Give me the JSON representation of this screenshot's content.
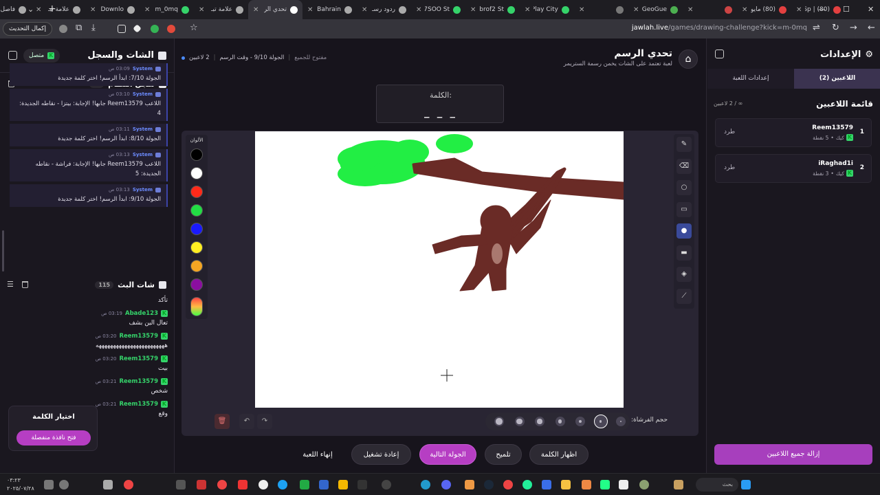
{
  "browser": {
    "tabs": [
      {
        "title": "(80) | Sp",
        "color": "#e34040"
      },
      {
        "title": "(80) مايو",
        "color": "#e34040"
      },
      {
        "title": "",
        "color": "#cc4444"
      },
      {
        "title": "GeoGue",
        "color": "#4caf50"
      },
      {
        "title": "",
        "color": "#777777"
      },
      {
        "title": "Play City",
        "color": "#35d36a"
      },
      {
        "title": "brof2 St",
        "color": "#35d36a"
      },
      {
        "title": "7SOO St",
        "color": "#35d36a"
      },
      {
        "title": "ردود رسـ",
        "color": "#aaaaaa"
      },
      {
        "title": "Bahrain",
        "color": "#aaaaaa"
      },
      {
        "title": "تحدي الر",
        "color": "#ffffff",
        "active": true
      },
      {
        "title": "علامة تبـ",
        "color": "#aaaaaa"
      },
      {
        "title": "m_0mq",
        "color": "#35d36a"
      },
      {
        "title": "Downlo",
        "color": "#aaaaaa"
      },
      {
        "title": "علامة تبـ",
        "color": "#aaaaaa"
      },
      {
        "title": "فاصل إعـ",
        "color": "#aaaaaa"
      }
    ],
    "url_host": "jawlah.live",
    "url_path": "/games/drawing-challenge?kick=m-0mq",
    "update_button": "إكمال التحديث"
  },
  "left_sidebar": {
    "title": "الشات والسجل",
    "status": "متصل",
    "system_log": {
      "title": "سجل النظام",
      "count": "22",
      "messages": [
        {
          "sender": "System",
          "time": "03:09 ص",
          "text": "الجولة 7/10: ابدأ الرسم! اختر كلمة جديدة"
        },
        {
          "sender": "System",
          "time": "03:10 ص",
          "text": "اللاعب Reem13579 جابها! الإجابة: بيتزا - نقاطه الجديدة: 4"
        },
        {
          "sender": "System",
          "time": "03:11 ص",
          "text": "الجولة 8/10: ابدأ الرسم! اختر كلمة جديدة"
        },
        {
          "sender": "System",
          "time": "03:13 ص",
          "text": "اللاعب Reem13579 جابها! الإجابة: فراشة - نقاطه الجديدة: 5"
        },
        {
          "sender": "System",
          "time": "03:13 ص",
          "text": "الجولة 9/10: ابدأ الرسم! اختر كلمة جديدة"
        }
      ]
    },
    "stream_chat": {
      "title": "شات البث",
      "count": "115",
      "messages": [
        {
          "user": "",
          "time": "",
          "text": "تأكد"
        },
        {
          "user": "Abade123",
          "time": "03:19 ص",
          "text": "تعال الين بشف"
        },
        {
          "user": "Reem13579",
          "time": "03:20 ص",
          "text": "ههههههههههههههههههههههههه"
        },
        {
          "user": "Reem13579",
          "time": "03:20 ص",
          "text": "بيت"
        },
        {
          "user": "Reem13579",
          "time": "03:21 ص",
          "text": "شخص"
        },
        {
          "user": "Reem13579",
          "time": "03:21 ص",
          "text": "وقع"
        }
      ]
    },
    "word_picker": {
      "title": "اختيار الكلمة",
      "button": "فتح نافذة منفصلة"
    }
  },
  "main": {
    "title": "تحدي الرسم",
    "subtitle": "لعبة تعتمد على الشات يخمن رسمة الستريمر",
    "players_count": "2 لاعبين",
    "round_info": "الجولة 9/10 - وقت الرسم",
    "mode": "مفتوح للجميع",
    "word_label": "الكلمة:",
    "word_mask": "_ _ _",
    "colors_label": "الألوان",
    "colors": [
      "#000000",
      "#ffffff",
      "#ff2a1a",
      "#22dd44",
      "#1a1aff",
      "#ffee22",
      "#f5a623",
      "#8a0ea0"
    ],
    "tools": [
      "pencil",
      "eraser",
      "circle",
      "rectangle",
      "dot",
      "filled-rect",
      "fill",
      "line"
    ],
    "active_tool": 4,
    "brush_label": "حجم الفرشاة:",
    "brush_sizes": [
      1,
      2,
      3,
      4,
      5,
      6,
      7
    ],
    "selected_brush": 1,
    "actions": {
      "show_word": "اظهار الكلمة",
      "hint": "تلميح",
      "next_round": "الجولة التالية",
      "restart": "إعادة تشغيل",
      "end_game": "إنهاء اللعبة"
    }
  },
  "right_sidebar": {
    "title": "الإعدادات",
    "tab_players": "اللاعبين (2)",
    "tab_settings": "إعدادات اللعبة",
    "list_title": "قائمة اللاعبين",
    "list_count": "∞ / 2 لاعبين",
    "players": [
      {
        "rank": "1",
        "name": "Reem13579",
        "platform": "كيك",
        "points": "5 نقطة",
        "kick": "طرد"
      },
      {
        "rank": "2",
        "name": "iRaghad1i",
        "platform": "كيك",
        "points": "3 نقطة",
        "kick": "طرد"
      }
    ],
    "remove_all": "إزالة جميع اللاعبين"
  },
  "taskbar": {
    "time": "٠٣:٢٣",
    "date": "٢٠٢٥/٠٧/٢٨",
    "search": "بحث"
  }
}
